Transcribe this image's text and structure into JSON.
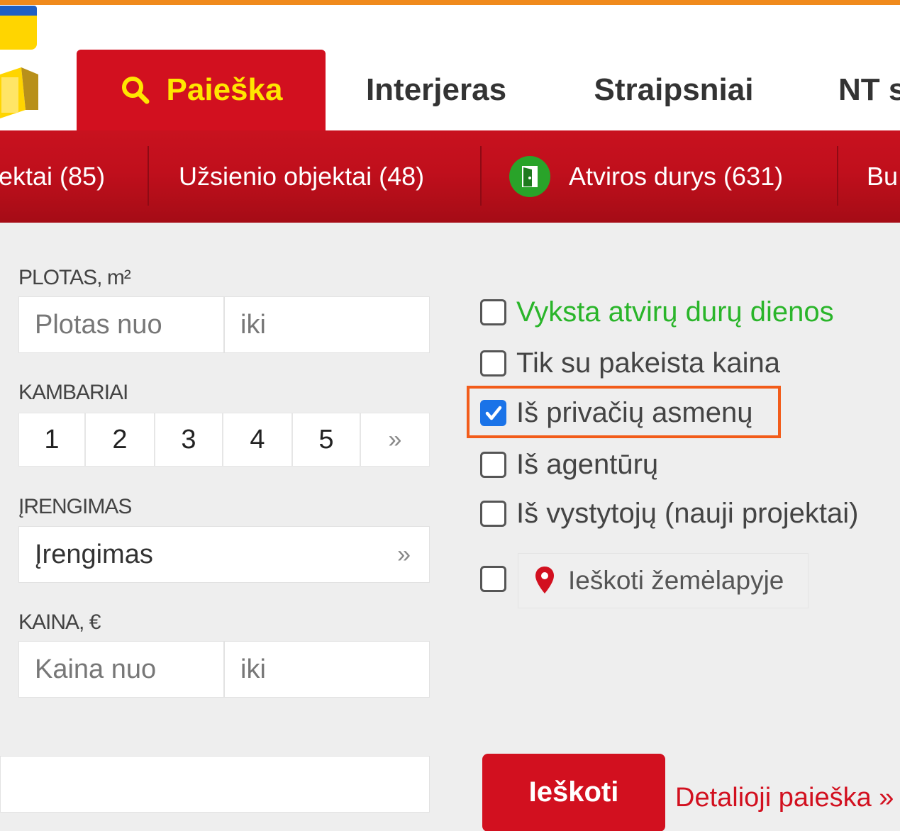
{
  "colors": {
    "brand_red": "#d2101f",
    "tab_text_active": "#ffe600",
    "accent_orange": "#f08a1c",
    "open_doors_green": "#2ab52a",
    "checkbox_blue": "#1a73e8",
    "highlight": "#f25c1a"
  },
  "nav": {
    "tabs": [
      {
        "label": "Paieška",
        "icon": "search-icon",
        "active": true
      },
      {
        "label": "Interjeras"
      },
      {
        "label": "Straipsniai"
      },
      {
        "label": "NT s"
      }
    ]
  },
  "subnav": {
    "items": [
      {
        "label": "ektai (85)"
      },
      {
        "label": "Užsienio objektai (48)"
      },
      {
        "label": "Atviros durys (631)",
        "icon": "door-icon"
      },
      {
        "label": "Bu"
      }
    ]
  },
  "form": {
    "area": {
      "label": "PLOTAS, m²",
      "from_placeholder": "Plotas nuo",
      "to_placeholder": "iki"
    },
    "rooms": {
      "label": "KAMBARIAI",
      "options": [
        "1",
        "2",
        "3",
        "4",
        "5"
      ],
      "more": "»"
    },
    "equipment": {
      "label": "ĮRENGIMAS",
      "value": "Įrengimas",
      "more": "»"
    },
    "price": {
      "label": "KAINA, €",
      "from_placeholder": "Kaina nuo",
      "to_placeholder": "iki"
    }
  },
  "filters": [
    {
      "label": "Vyksta atvirų durų dienos",
      "checked": false
    },
    {
      "label": "Tik su pakeista kaina",
      "checked": false
    },
    {
      "label": "Iš privačių asmenų",
      "checked": true
    },
    {
      "label": "Iš agentūrų",
      "checked": false
    },
    {
      "label": "Iš vystytojų (nauji projektai)",
      "checked": false
    }
  ],
  "map_search": {
    "label": "Ieškoti žemėlapyje",
    "checked": false,
    "icon": "map-pin-icon"
  },
  "actions": {
    "search_label": "Ieškoti",
    "detail_link": "Detalioji paieška »"
  }
}
